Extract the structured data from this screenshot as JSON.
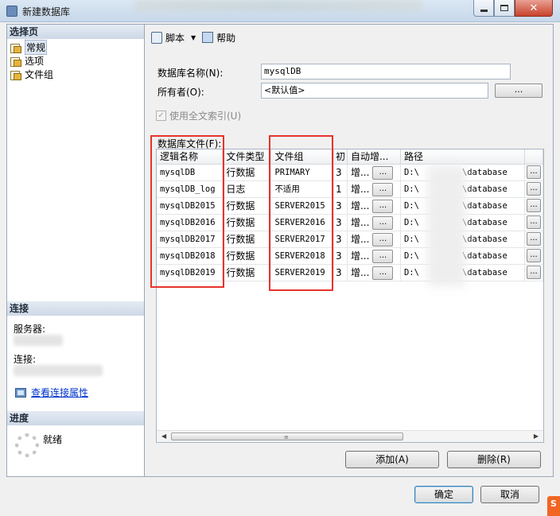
{
  "window": {
    "title": "新建数据库"
  },
  "left": {
    "select_page_header": "选择页",
    "pages": [
      {
        "label": "常规",
        "selected": true
      },
      {
        "label": "选项",
        "selected": false
      },
      {
        "label": "文件组",
        "selected": false
      }
    ],
    "connection_header": "连接",
    "server_label": "服务器:",
    "connection_label": "连接:",
    "view_conn_props": "查看连接属性",
    "progress_header": "进度",
    "ready": "就绪"
  },
  "toolbar": {
    "script": "脚本",
    "help": "帮助"
  },
  "form": {
    "db_name_label": "数据库名称(N):",
    "db_name_value": "mysqlDB",
    "owner_label": "所有者(O):",
    "owner_value": "<默认值>",
    "owner_browse": "...",
    "fulltext_label": "使用全文索引(U)",
    "files_label": "数据库文件(F):"
  },
  "grid": {
    "columns": [
      "逻辑名称",
      "文件类型",
      "文件组",
      "初",
      "自动增...",
      "路径"
    ],
    "rows": [
      {
        "name": "mysqlDB",
        "type": "行数据",
        "group": "PRIMARY",
        "init": "3",
        "auto": "增...",
        "path_start": "D:\\",
        "path_end": "\\database"
      },
      {
        "name": "mysqlDB_log",
        "type": "日志",
        "group": "不适用",
        "init": "1",
        "auto": "增...",
        "path_start": "D:\\",
        "path_end": "\\database"
      },
      {
        "name": "mysqlDB2015",
        "type": "行数据",
        "group": "SERVER2015",
        "init": "3",
        "auto": "增...",
        "path_start": "D:\\",
        "path_end": "\\database"
      },
      {
        "name": "mysqlDB2016",
        "type": "行数据",
        "group": "SERVER2016",
        "init": "3",
        "auto": "增...",
        "path_start": "D:\\",
        "path_end": "\\database"
      },
      {
        "name": "mysqlDB2017",
        "type": "行数据",
        "group": "SERVER2017",
        "init": "3",
        "auto": "增...",
        "path_start": "D:\\",
        "path_end": "\\database"
      },
      {
        "name": "mysqlDB2018",
        "type": "行数据",
        "group": "SERVER2018",
        "init": "3",
        "auto": "增...",
        "path_start": "D:\\",
        "path_end": "\\database"
      },
      {
        "name": "mysqlDB2019",
        "type": "行数据",
        "group": "SERVER2019",
        "init": "3",
        "auto": "增...",
        "path_start": "D:\\",
        "path_end": "\\database"
      }
    ],
    "ellipsis": "..."
  },
  "buttons": {
    "add": "添加(A)",
    "remove": "删除(R)",
    "ok": "确定",
    "cancel": "取消"
  },
  "colors": {
    "highlight": "#e8332c",
    "link": "#0033cc"
  }
}
